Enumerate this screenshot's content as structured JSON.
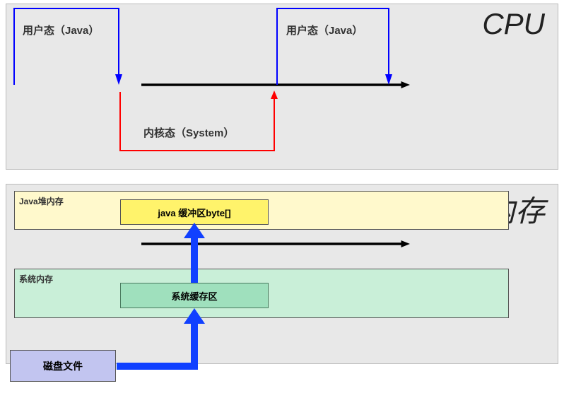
{
  "cpu_section": {
    "title": "CPU",
    "user_mode_label_1": "用户态（Java）",
    "user_mode_label_2": "用户态（Java）",
    "kernel_mode_label": "内核态（System）"
  },
  "memory_section": {
    "title": "内存",
    "heap_label": "Java堆内存",
    "java_buffer_label": "java 缓冲区byte[]",
    "sysmem_label": "系统内存",
    "syscache_label": "系统缓存区",
    "disk_label": "磁盘文件"
  },
  "colors": {
    "panel_bg": "#e8e8e8",
    "heap_bg": "#fff9cc",
    "buffer_bg": "#fff36b",
    "sysmem_bg": "#c9efd8",
    "syscache_bg": "#9fe0bd",
    "disk_bg": "#c2c5f0",
    "arrow_blue": "#0000ff",
    "arrow_red": "#ff0000",
    "arrow_thick_blue": "#1040ff",
    "timeline_black": "#000000"
  }
}
